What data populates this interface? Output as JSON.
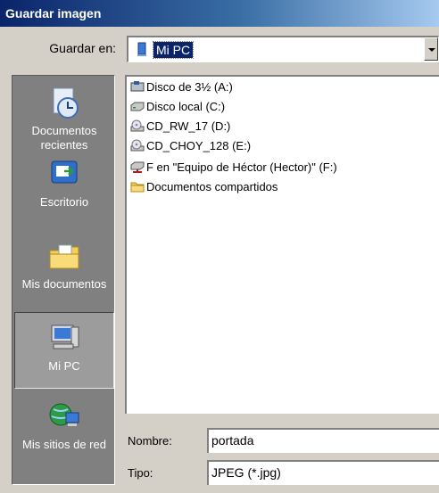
{
  "window": {
    "title": "Guardar imagen"
  },
  "lookin": {
    "label": "Guardar en:",
    "value": "Mi PC"
  },
  "places": [
    {
      "label": "Documentos\nrecientes",
      "icon": "recent-documents-icon"
    },
    {
      "label": "Escritorio",
      "icon": "desktop-icon"
    },
    {
      "label": "Mis documentos",
      "icon": "my-documents-icon"
    },
    {
      "label": "Mi PC",
      "icon": "my-computer-icon",
      "selected": true
    },
    {
      "label": "Mis sitios de red",
      "icon": "network-places-icon"
    }
  ],
  "files": [
    {
      "name": "Disco de 3½ (A:)",
      "icon": "floppy-drive-icon"
    },
    {
      "name": "Disco local (C:)",
      "icon": "hard-drive-icon"
    },
    {
      "name": "CD_RW_17 (D:)",
      "icon": "cd-drive-icon"
    },
    {
      "name": "CD_CHOY_128 (E:)",
      "icon": "cd-drive-icon"
    },
    {
      "name": "F en \"Equipo de Héctor (Hector)\" (F:)",
      "icon": "network-drive-icon"
    },
    {
      "name": "Documentos compartidos",
      "icon": "shared-folder-icon"
    }
  ],
  "filename": {
    "label": "Nombre:",
    "value": "portada"
  },
  "filetype": {
    "label": "Tipo:",
    "value": "JPEG (*.jpg)"
  },
  "colors": {
    "title_start": "#0a246a",
    "title_end": "#a6caf0",
    "dialog_bg": "#d4d0c8",
    "places_bg": "#808080"
  }
}
